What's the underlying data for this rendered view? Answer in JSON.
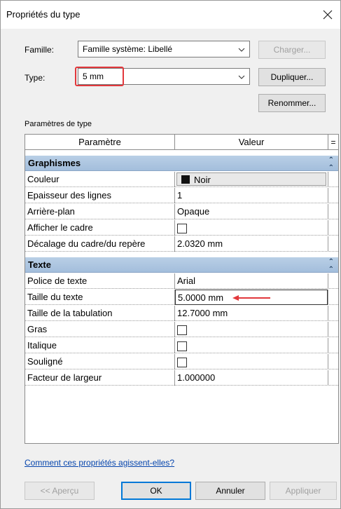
{
  "window": {
    "title": "Propriétés du type"
  },
  "famille": {
    "label": "Famille:",
    "value": "Famille système: Libellé"
  },
  "type": {
    "label": "Type:",
    "value": "5 mm"
  },
  "buttons": {
    "charger": "Charger...",
    "dupliquer": "Dupliquer...",
    "renommer": "Renommer...",
    "apercu": "<< Aperçu",
    "ok": "OK",
    "annuler": "Annuler",
    "appliquer": "Appliquer"
  },
  "section_label": "Paramètres de type",
  "table": {
    "col_param": "Paramètre",
    "col_value": "Valeur",
    "col_extra": "=",
    "groups": [
      {
        "name": "Graphismes",
        "collapse_icon": "double-chevron-up-icon"
      },
      {
        "name": "Texte",
        "collapse_icon": "double-chevron-up-icon"
      }
    ],
    "rows": [
      {
        "name": "Couleur",
        "value": "Noir",
        "kind": "color",
        "swatch": "#111111"
      },
      {
        "name": "Epaisseur des lignes",
        "value": "1"
      },
      {
        "name": "Arrière-plan",
        "value": "Opaque"
      },
      {
        "name": "Afficher le cadre",
        "value": "",
        "kind": "checkbox",
        "checked": false
      },
      {
        "name": "Décalage du cadre/du repère",
        "value": "2.0320 mm"
      },
      {
        "name": "Police de texte",
        "value": "Arial"
      },
      {
        "name": "Taille du texte",
        "value": "5.0000 mm",
        "kind": "editing"
      },
      {
        "name": "Taille de la tabulation",
        "value": "12.7000 mm"
      },
      {
        "name": "Gras",
        "value": "",
        "kind": "checkbox",
        "checked": false
      },
      {
        "name": "Italique",
        "value": "",
        "kind": "checkbox",
        "checked": false
      },
      {
        "name": "Souligné",
        "value": "",
        "kind": "checkbox",
        "checked": false
      },
      {
        "name": "Facteur de largeur",
        "value": "1.000000"
      }
    ]
  },
  "help_link": "Comment ces propriétés agissent-elles?",
  "colors": {
    "highlight": "#e2383c",
    "group_bg": "#a8c2df",
    "link": "#0645ad"
  }
}
